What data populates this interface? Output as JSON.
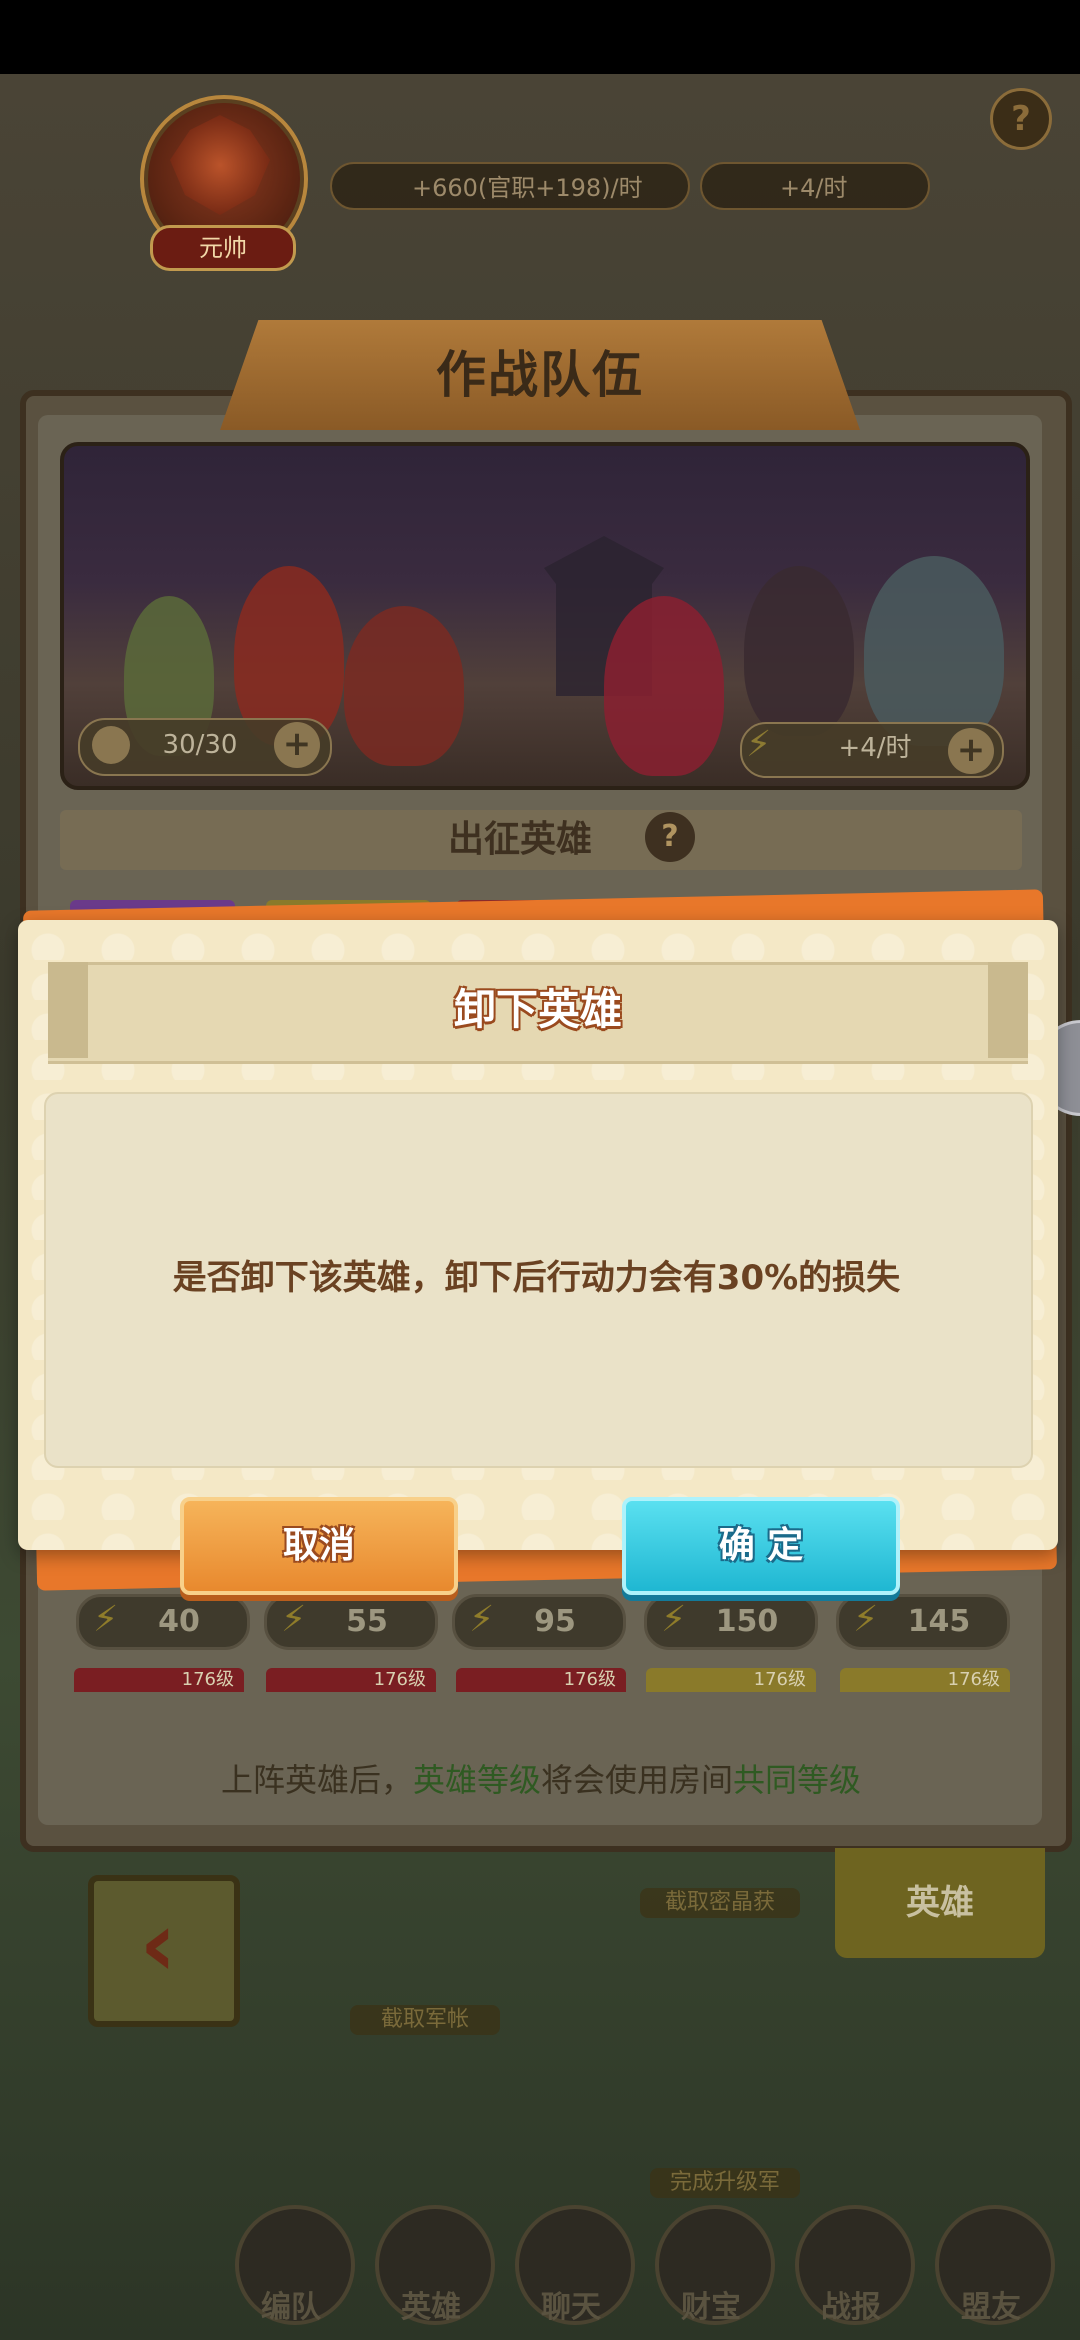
{
  "hud": {
    "rank_label": "元帅",
    "income_text": "+660(官职+198)/时",
    "energy_rate_text": "+4/时",
    "help_icon": "question-icon"
  },
  "panel": {
    "title": "作战队伍",
    "team_count": "30/30",
    "energy_rate": "+4/时",
    "section_title": "出征英雄",
    "hero_energy_values": [
      "40",
      "55",
      "95",
      "150",
      "145"
    ],
    "level_labels": [
      "176级",
      "176级",
      "176级",
      "176级",
      "176级"
    ],
    "notice": {
      "part1": "上阵英雄后，",
      "highlight1": "英雄等级",
      "part2": "将会使用房间",
      "highlight2": "共同等级"
    }
  },
  "bottom": {
    "hero_tab_label": "英雄",
    "map_label_1": "截取密晶获",
    "map_label_2": "截取军帐",
    "map_label_3": "完成升级军",
    "nav": [
      "编队",
      "英雄",
      "聊天",
      "财宝",
      "战报",
      "盟友"
    ]
  },
  "dialog": {
    "title": "卸下英雄",
    "message": "是否卸下该英雄，卸下后行动力会有30%的损失",
    "cancel_label": "取消",
    "confirm_label": "确 定"
  },
  "colors": {
    "dialog_accent": "#e8772a",
    "cancel_button": "#f0a043",
    "confirm_button": "#2cc6de",
    "highlight_text": "#2f5a22"
  }
}
